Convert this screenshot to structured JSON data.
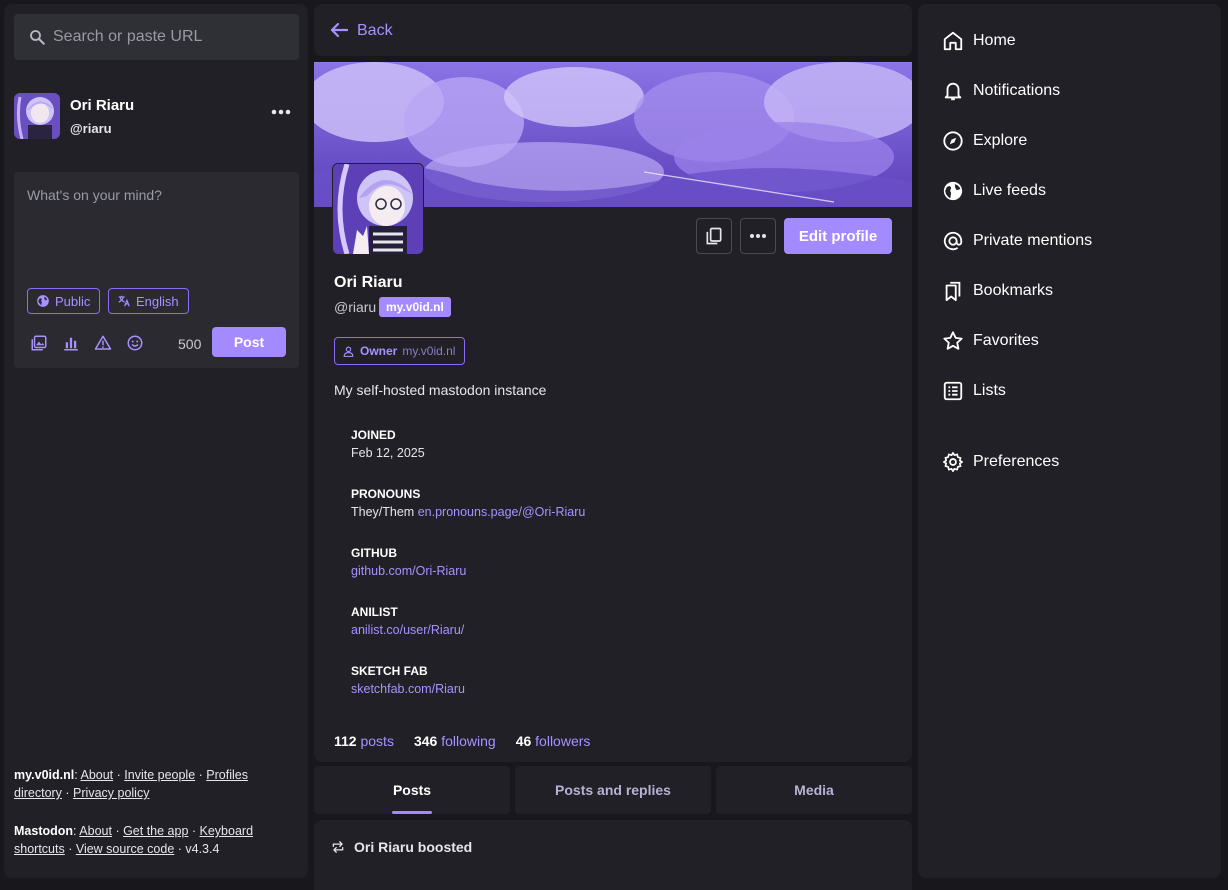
{
  "search": {
    "placeholder": "Search or paste URL"
  },
  "account": {
    "name": "Ori Riaru",
    "handle": "@riaru"
  },
  "compose": {
    "placeholder": "What's on your mind?",
    "visibility": "Public",
    "language": "English",
    "char_count": "500",
    "post_label": "Post"
  },
  "left_footer": {
    "server": "my.v0id.nl",
    "server_links": {
      "about": "About",
      "invite": "Invite people",
      "profiles": "Profiles directory",
      "privacy": "Privacy policy"
    },
    "mastodon": "Mastodon",
    "mastodon_links": {
      "about": "About",
      "get_app": "Get the app",
      "shortcuts": "Keyboard shortcuts",
      "source": "View source code"
    },
    "version": "v4.3.4"
  },
  "header": {
    "back_label": "Back"
  },
  "profile": {
    "name": "Ori Riaru",
    "handle": "@riaru",
    "domain": "my.v0id.nl",
    "edit_label": "Edit profile",
    "role": {
      "label": "Owner",
      "domain": "my.v0id.nl"
    },
    "bio": "My self-hosted mastodon instance",
    "fields": [
      {
        "key": "JOINED",
        "value": "Feb 12, 2025"
      },
      {
        "key": "PRONOUNS",
        "value": "They/Them",
        "link": "en.pronouns.page/@Ori-Riaru"
      },
      {
        "key": "GITHUB",
        "link": "github.com/Ori-Riaru"
      },
      {
        "key": "ANILIST",
        "link": "anilist.co/user/Riaru/"
      },
      {
        "key": "SKETCH FAB",
        "link": "sketchfab.com/Riaru"
      }
    ],
    "stats": {
      "posts_count": "112",
      "posts_label": "posts",
      "following_count": "346",
      "following_label": "following",
      "followers_count": "46",
      "followers_label": "followers"
    }
  },
  "tabs": [
    "Posts",
    "Posts and replies",
    "Media"
  ],
  "feed": {
    "boost_text": "Ori Riaru boosted"
  },
  "nav": {
    "home": "Home",
    "notifications": "Notifications",
    "explore": "Explore",
    "live_feeds": "Live feeds",
    "private_mentions": "Private mentions",
    "bookmarks": "Bookmarks",
    "favorites": "Favorites",
    "lists": "Lists",
    "preferences": "Preferences"
  },
  "colors": {
    "accent": "#a38aff",
    "panel": "#202026",
    "background": "#17171c"
  }
}
